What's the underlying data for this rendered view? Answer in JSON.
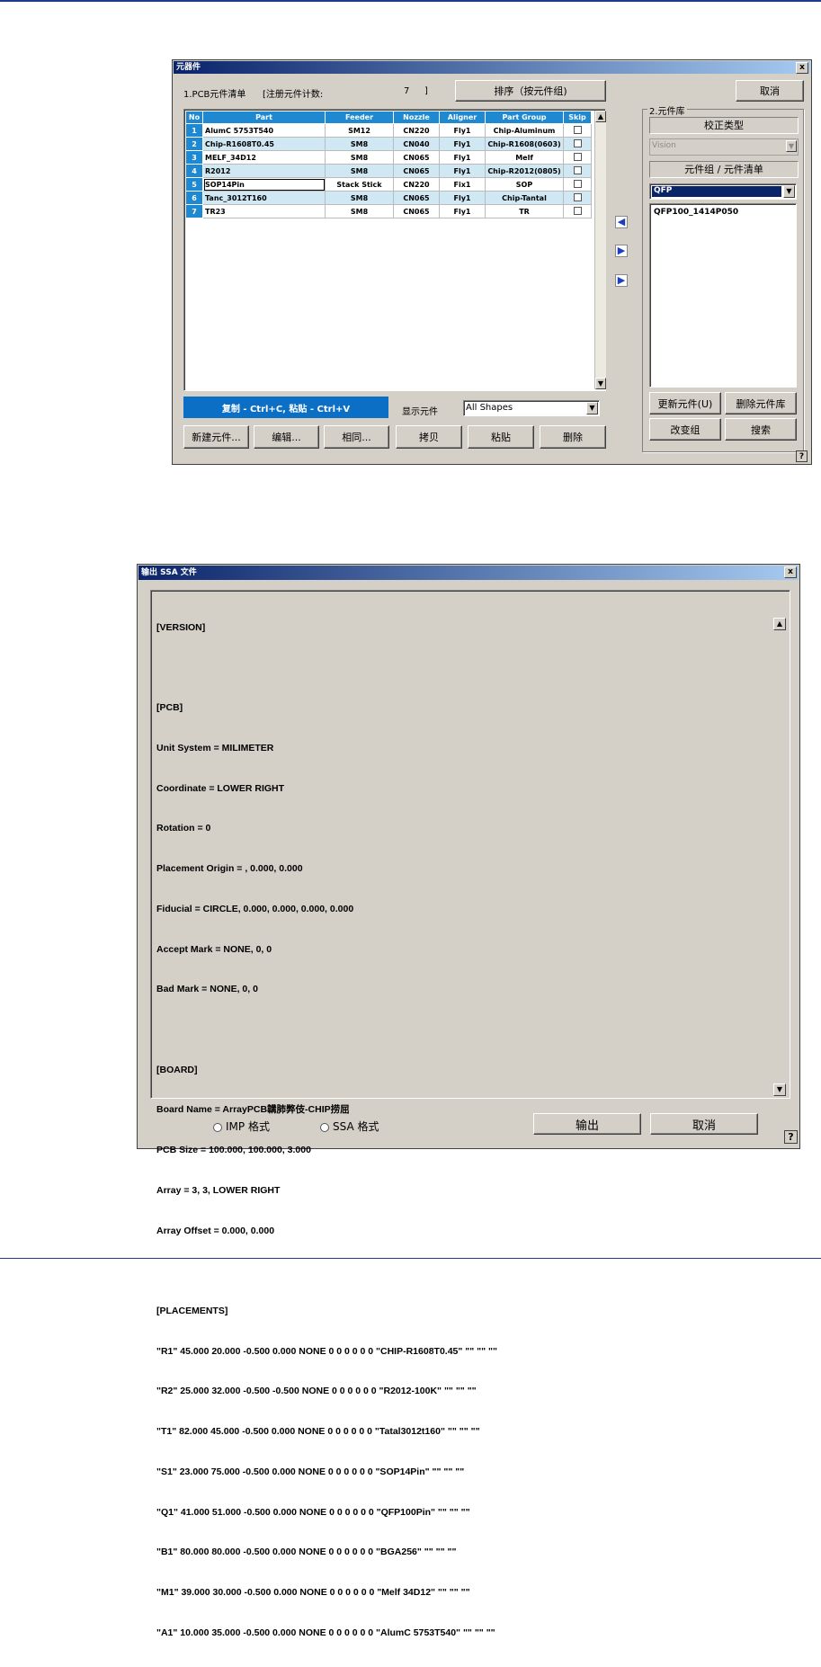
{
  "dialog1": {
    "title": "元器件",
    "close": "x",
    "pcb_list_label": "1.PCB元件清单",
    "registered_count_label": "[注册元件计数:",
    "registered_count": "7",
    "registered_count_close": "]",
    "sort_button": "排序（按元件组)",
    "cancel_button": "取消",
    "table": {
      "columns": [
        "No",
        "Part",
        "Feeder",
        "Nozzle",
        "Aligner",
        "Part Group",
        "Skip"
      ],
      "rows": [
        {
          "no": "1",
          "part": "AlumC 5753T540",
          "feeder": "SM12",
          "nozzle": "CN220",
          "aligner": "Fly1",
          "group": "Chip-Aluminum"
        },
        {
          "no": "2",
          "part": "Chip-R1608T0.45",
          "feeder": "SM8",
          "nozzle": "CN040",
          "aligner": "Fly1",
          "group": "Chip-R1608(0603)"
        },
        {
          "no": "3",
          "part": "MELF_34D12",
          "feeder": "SM8",
          "nozzle": "CN065",
          "aligner": "Fly1",
          "group": "Melf"
        },
        {
          "no": "4",
          "part": "R2012",
          "feeder": "SM8",
          "nozzle": "CN065",
          "aligner": "Fly1",
          "group": "Chip-R2012(0805)"
        },
        {
          "no": "5",
          "part": "SOP14Pin",
          "feeder": "Stack Stick",
          "nozzle": "CN220",
          "aligner": "Fix1",
          "group": "SOP"
        },
        {
          "no": "6",
          "part": "Tanc_3012T160",
          "feeder": "SM8",
          "nozzle": "CN065",
          "aligner": "Fly1",
          "group": "Chip-Tantal"
        },
        {
          "no": "7",
          "part": "TR23",
          "feeder": "SM8",
          "nozzle": "CN065",
          "aligner": "Fly1",
          "group": "TR"
        }
      ]
    },
    "copy_paste_hint": "复制 - Ctrl+C, 粘贴 - Ctrl+V",
    "show_parts_label": "显示元件",
    "show_parts_value": "All Shapes",
    "buttons": {
      "new_part": "新建元件...",
      "edit": "编辑...",
      "same": "相同...",
      "copy": "拷贝",
      "paste": "粘贴",
      "delete": "删除"
    },
    "library": {
      "group_label": "2.元件库",
      "calib_type_label": "校正类型",
      "calib_type_value": "Vision",
      "group_list_label": "元件组 / 元件清单",
      "group_value": "QFP",
      "list_items": [
        "QFP100_1414P050"
      ],
      "update_button": "更新元件(U)",
      "delete_lib_button": "删除元件库",
      "change_group_button": "改变组",
      "search_button": "搜索"
    },
    "help": "?"
  },
  "dialog2": {
    "title": "输出 SSA 文件",
    "close": "x",
    "content_lines": [
      "[VERSION]",
      "",
      "[PCB]",
      "Unit System = MILIMETER",
      "Coordinate = LOWER RIGHT",
      "Rotation = 0",
      "Placement Origin = , 0.000, 0.000",
      "Fiducial = CIRCLE, 0.000, 0.000, 0.000, 0.000",
      "Accept Mark = NONE, 0, 0",
      "Bad Mark = NONE, 0, 0",
      "",
      "[BOARD]",
      "Board Name = ArrayPCB韝肺弊伎-CHIP捞屈",
      "PCB Size = 100.000, 100.000, 3.000",
      "Array = 3, 3, LOWER RIGHT",
      "Array Offset = 0.000, 0.000",
      "",
      "[PLACEMENTS]",
      "\"R1\" 45.000 20.000 -0.500 0.000 NONE 0 0 0 0 0 0 \"CHIP-R1608T0.45\" \"\" \"\" \"\"",
      "\"R2\" 25.000 32.000 -0.500 -0.500 NONE 0 0 0 0 0 0 \"R2012-100K\" \"\" \"\" \"\"",
      "\"T1\" 82.000 45.000 -0.500 0.000 NONE 0 0 0 0 0 0 \"Tatal3012t160\" \"\" \"\" \"\"",
      "\"S1\" 23.000 75.000 -0.500 0.000 NONE 0 0 0 0 0 0 \"SOP14Pin\" \"\" \"\" \"\"",
      "\"Q1\" 41.000 51.000 -0.500 0.000 NONE 0 0 0 0 0 0 \"QFP100Pin\" \"\" \"\" \"\"",
      "\"B1\" 80.000 80.000 -0.500 0.000 NONE 0 0 0 0 0 0 \"BGA256\" \"\" \"\" \"\"",
      "\"M1\" 39.000 30.000 -0.500 0.000 NONE 0 0 0 0 0 0 \"Melf 34D12\" \"\" \"\" \"\"",
      "\"A1\" 10.000 35.000 -0.500 0.000 NONE 0 0 0 0 0 0 \"AlumC 5753T540\" \"\" \"\" \"\""
    ],
    "imp_format_label": "IMP 格式",
    "ssa_format_label": "SSA 格式",
    "output_button": "输出",
    "cancel_button": "取消",
    "help": "?"
  }
}
